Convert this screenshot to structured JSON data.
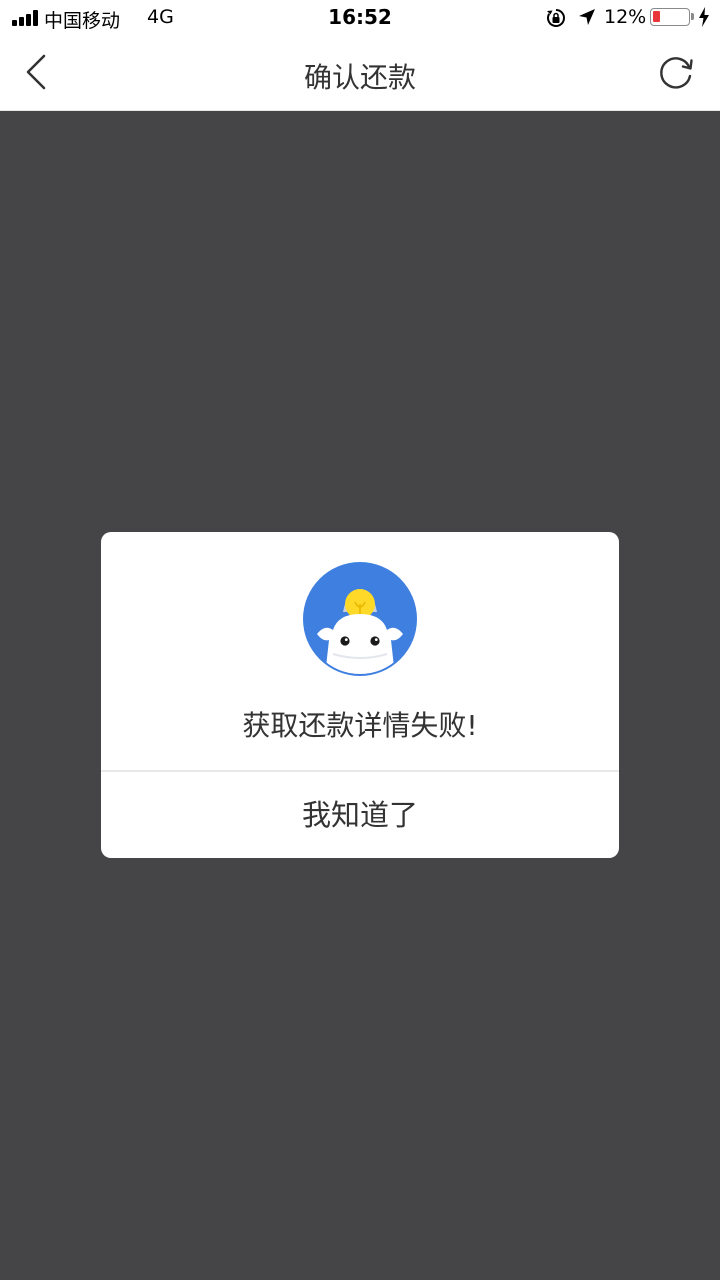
{
  "status_bar": {
    "carrier": "中国移动",
    "network": "4G",
    "time": "16:52",
    "battery_percent_label": "12%",
    "battery_level": 0.12,
    "icons": [
      "signal-icon",
      "rotation-lock-icon",
      "location-arrow-icon",
      "battery-icon",
      "charging-bolt-icon"
    ]
  },
  "nav": {
    "title": "确认还款",
    "back_icon": "chevron-left-icon",
    "refresh_icon": "refresh-icon"
  },
  "dialog": {
    "logo_icon": "mascot-logo-icon",
    "message": "获取还款详情失败!",
    "button_label": "我知道了"
  },
  "colors": {
    "overlay": "#454547",
    "logo_blue": "#3e7fdf",
    "bulb_yellow": "#ffd928",
    "battery_low": "#e8363a"
  }
}
